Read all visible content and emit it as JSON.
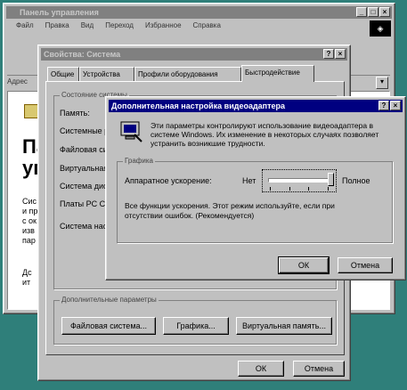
{
  "control_panel": {
    "title": "Панель управления",
    "menu": [
      "Файл",
      "Правка",
      "Вид",
      "Переход",
      "Избранное",
      "Справка"
    ],
    "address_label": "Адрес",
    "big_title_lines": [
      "Па",
      "уп"
    ],
    "side_text": [
      "Сис",
      "и пр",
      "с ок",
      "изв",
      "пар"
    ],
    "side_text_bottom": [
      "Дс",
      "ит"
    ]
  },
  "system_props": {
    "title": "Свойства: Система",
    "tabs": [
      "Общие",
      "Устройства",
      "Профили оборудования",
      "Быстродействие"
    ],
    "status_group": "Состояние системы",
    "rows": [
      "Память:",
      "Системные ресурсы:",
      "Файловая система:",
      "Виртуальная память:",
      "Система диска:",
      "Платы PC Card:"
    ],
    "system_row": "Система настроена на оптимальную производительность.",
    "advanced_group": "Дополнительные параметры",
    "adv_buttons": [
      "Файловая система...",
      "Графика...",
      "Виртуальная память..."
    ],
    "ok": "ОК",
    "cancel": "Отмена"
  },
  "video_dialog": {
    "title": "Дополнительная настройка видеоадаптера",
    "intro": "Эти параметры контролируют использование видеоадаптера в системе Windows. Их изменение в некоторых случаях позволяет устранить возникшие трудности.",
    "graphics_group": "Графика",
    "accel_label": "Аппаратное ускорение:",
    "slider_min": "Нет",
    "slider_max": "Полное",
    "slider_level": 1.0,
    "description": "Все функции ускорения. Этот режим используйте, если при отсутствии ошибок. (Рекомендуется)",
    "ok": "ОК",
    "cancel": "Отмена"
  }
}
